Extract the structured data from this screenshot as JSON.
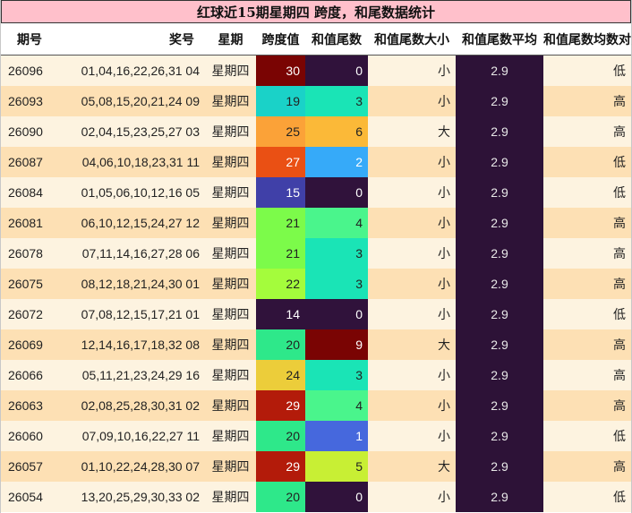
{
  "title": "红球近15期星期四 跨度，和尾数据统计",
  "headers": [
    "期号",
    "奖号",
    "星期",
    "跨度值",
    "和值尾数",
    "和值尾数大小",
    "和值尾数平均",
    "和值尾数均数对比"
  ],
  "rows": [
    {
      "qi": "26096",
      "jh": "01,04,16,22,26,31 04",
      "xq": "星期四",
      "kd": "30",
      "hw": "0",
      "dx": "小",
      "pj": "2.9",
      "db": "低",
      "kd_color": "#7a0403",
      "hw_color": "#30123b",
      "kd_dark": false,
      "hw_dark": false
    },
    {
      "qi": "26093",
      "jh": "05,08,15,20,21,24 09",
      "xq": "星期四",
      "kd": "19",
      "hw": "3",
      "dx": "小",
      "pj": "2.9",
      "db": "高",
      "kd_color": "#1ad2c8",
      "hw_color": "#1ae4b6",
      "kd_dark": true,
      "hw_dark": true
    },
    {
      "qi": "26090",
      "jh": "02,04,15,23,25,27 03",
      "xq": "星期四",
      "kd": "25",
      "hw": "6",
      "dx": "大",
      "pj": "2.9",
      "db": "高",
      "kd_color": "#fba238",
      "hw_color": "#fbb938",
      "kd_dark": true,
      "hw_dark": true
    },
    {
      "qi": "26087",
      "jh": "04,06,10,18,23,31 11",
      "xq": "星期四",
      "kd": "27",
      "hw": "2",
      "dx": "小",
      "pj": "2.9",
      "db": "低",
      "kd_color": "#ea5014",
      "hw_color": "#36aaf9",
      "kd_dark": false,
      "hw_dark": false
    },
    {
      "qi": "26084",
      "jh": "01,05,06,10,12,16 05",
      "xq": "星期四",
      "kd": "15",
      "hw": "0",
      "dx": "小",
      "pj": "2.9",
      "db": "低",
      "kd_color": "#4040a8",
      "hw_color": "#30123b",
      "kd_dark": false,
      "hw_dark": false
    },
    {
      "qi": "26081",
      "jh": "06,10,12,15,24,27 12",
      "xq": "星期四",
      "kd": "21",
      "hw": "4",
      "dx": "小",
      "pj": "2.9",
      "db": "高",
      "kd_color": "#7cfb4a",
      "hw_color": "#4af58c",
      "kd_dark": true,
      "hw_dark": true
    },
    {
      "qi": "26078",
      "jh": "07,11,14,16,27,28 06",
      "xq": "星期四",
      "kd": "21",
      "hw": "3",
      "dx": "小",
      "pj": "2.9",
      "db": "高",
      "kd_color": "#7cfb4a",
      "hw_color": "#1ae4b6",
      "kd_dark": true,
      "hw_dark": true
    },
    {
      "qi": "26075",
      "jh": "08,12,18,21,24,30 01",
      "xq": "星期四",
      "kd": "22",
      "hw": "3",
      "dx": "小",
      "pj": "2.9",
      "db": "高",
      "kd_color": "#a4fc3c",
      "hw_color": "#1ae4b6",
      "kd_dark": true,
      "hw_dark": true
    },
    {
      "qi": "26072",
      "jh": "07,08,12,15,17,21 01",
      "xq": "星期四",
      "kd": "14",
      "hw": "0",
      "dx": "小",
      "pj": "2.9",
      "db": "低",
      "kd_color": "#30123b",
      "hw_color": "#30123b",
      "kd_dark": false,
      "hw_dark": false
    },
    {
      "qi": "26069",
      "jh": "12,14,16,17,18,32 08",
      "xq": "星期四",
      "kd": "20",
      "hw": "9",
      "dx": "大",
      "pj": "2.9",
      "db": "高",
      "kd_color": "#2ee88a",
      "hw_color": "#7a0403",
      "kd_dark": true,
      "hw_dark": false
    },
    {
      "qi": "26066",
      "jh": "05,11,21,23,24,29 16",
      "xq": "星期四",
      "kd": "24",
      "hw": "3",
      "dx": "小",
      "pj": "2.9",
      "db": "高",
      "kd_color": "#eccd3a",
      "hw_color": "#1ae4b6",
      "kd_dark": true,
      "hw_dark": true
    },
    {
      "qi": "26063",
      "jh": "02,08,25,28,30,31 02",
      "xq": "星期四",
      "kd": "29",
      "hw": "4",
      "dx": "小",
      "pj": "2.9",
      "db": "高",
      "kd_color": "#b31b0a",
      "hw_color": "#4af58c",
      "kd_dark": false,
      "hw_dark": true
    },
    {
      "qi": "26060",
      "jh": "07,09,10,16,22,27 11",
      "xq": "星期四",
      "kd": "20",
      "hw": "1",
      "dx": "小",
      "pj": "2.9",
      "db": "低",
      "kd_color": "#2ee88a",
      "hw_color": "#4668dd",
      "kd_dark": true,
      "hw_dark": false
    },
    {
      "qi": "26057",
      "jh": "01,10,22,24,28,30 07",
      "xq": "星期四",
      "kd": "29",
      "hw": "5",
      "dx": "大",
      "pj": "2.9",
      "db": "高",
      "kd_color": "#b31b0a",
      "hw_color": "#c8ef34",
      "kd_dark": false,
      "hw_dark": true
    },
    {
      "qi": "26054",
      "jh": "13,20,25,29,30,33 02",
      "xq": "星期四",
      "kd": "20",
      "hw": "0",
      "dx": "小",
      "pj": "2.9",
      "db": "低",
      "kd_color": "#2ee88a",
      "hw_color": "#30123b",
      "kd_dark": true,
      "hw_dark": false
    }
  ],
  "colors": {
    "title_bg": "#ffc0cb",
    "row_odd": "#fdf3e0",
    "row_even": "#fde0b4",
    "avg_bg": "#2d1237"
  }
}
